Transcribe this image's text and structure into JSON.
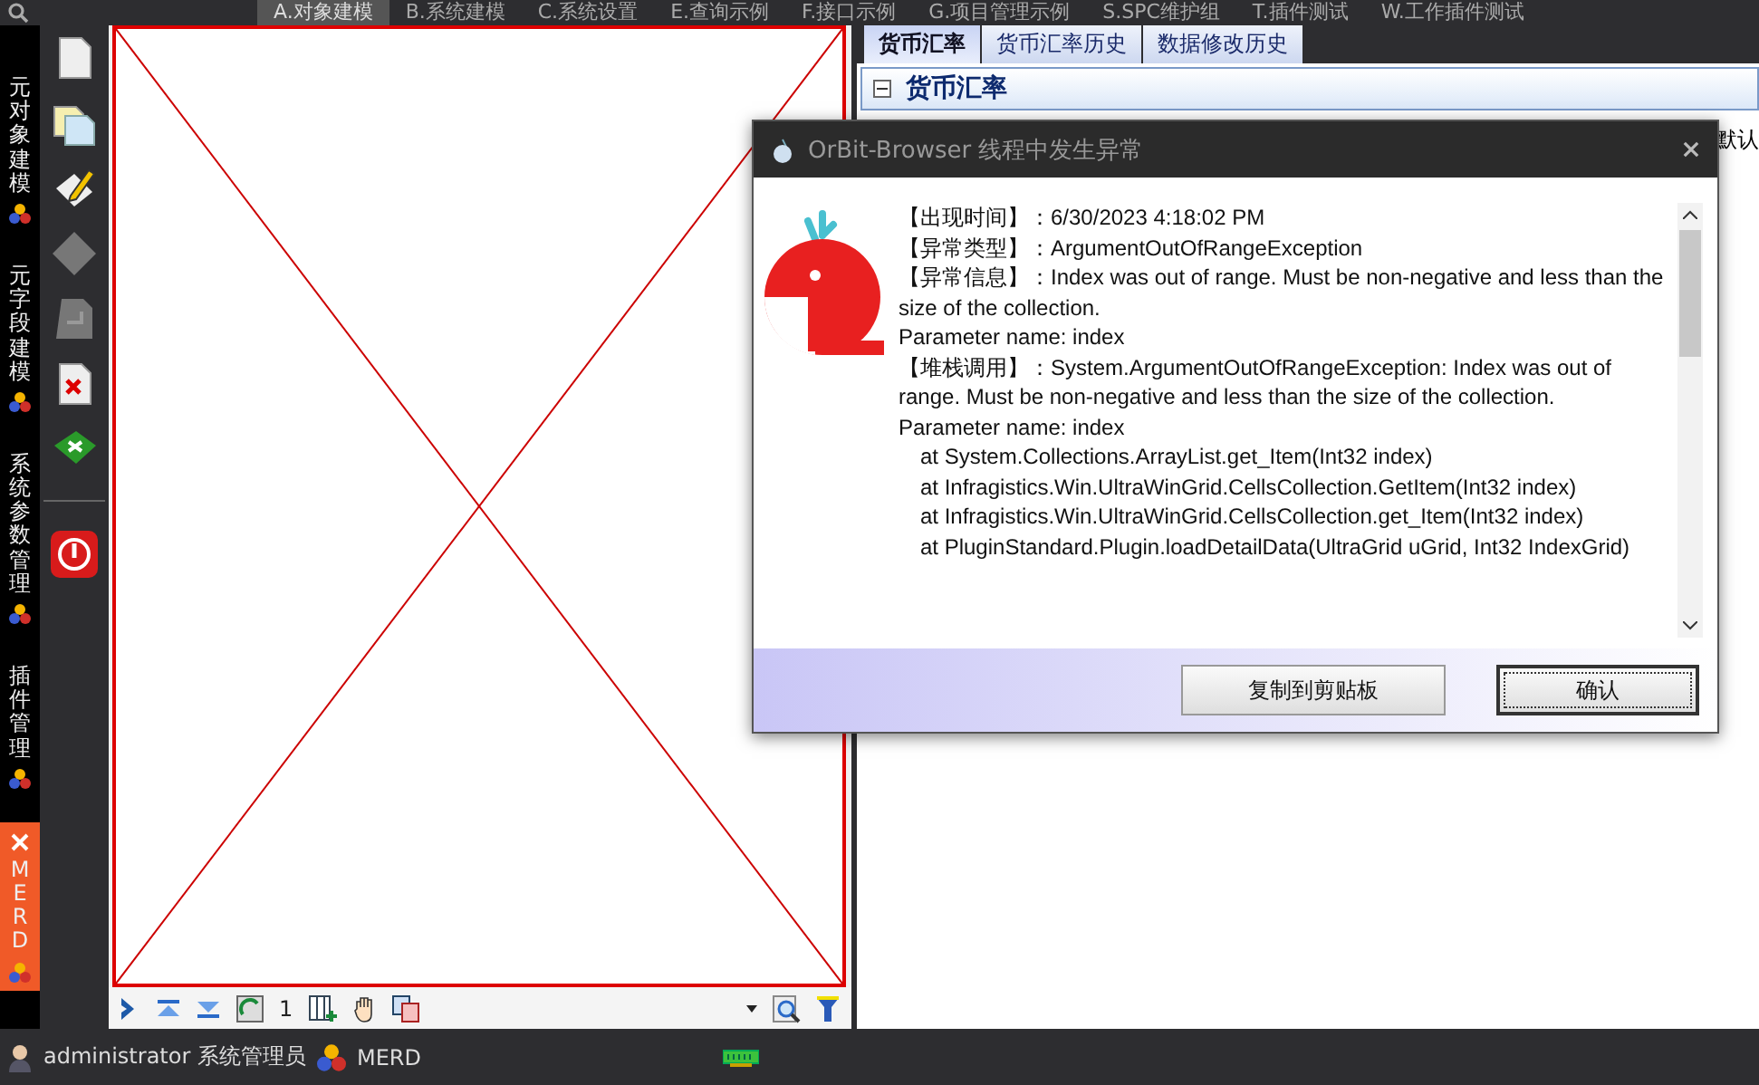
{
  "menu": [
    {
      "label": "A.对象建模",
      "selected": true
    },
    {
      "label": "B.系统建模",
      "selected": false
    },
    {
      "label": "C.系统设置",
      "selected": false
    },
    {
      "label": "E.查询示例",
      "selected": false
    },
    {
      "label": "F.接口示例",
      "selected": false
    },
    {
      "label": "G.项目管理示例",
      "selected": false
    },
    {
      "label": "S.SPC维护组",
      "selected": false
    },
    {
      "label": "T.插件测试",
      "selected": false
    },
    {
      "label": "W.工作插件测试",
      "selected": false
    }
  ],
  "side_tabs": [
    {
      "label": "元对象建模",
      "selected": false,
      "closable": false
    },
    {
      "label": "元字段建模",
      "selected": false,
      "closable": false
    },
    {
      "label": "系统参数管理",
      "selected": false,
      "closable": false
    },
    {
      "label": "插件管理",
      "selected": false,
      "closable": false
    },
    {
      "label": "MERD",
      "selected": true,
      "closable": true
    }
  ],
  "canvas_toolbar": {
    "page": "1"
  },
  "panel": {
    "tabs": [
      {
        "label": "货币汇率",
        "selected": true
      },
      {
        "label": "货币汇率历史",
        "selected": false
      },
      {
        "label": "数据修改历史",
        "selected": false
      }
    ],
    "section_title": "货币汇率",
    "side_label": "默认"
  },
  "dialog": {
    "title": "OrBit-Browser 线程中发生异常",
    "message": [
      {
        "label": "【出现时间】",
        "text": "：6/30/2023 4:18:02 PM"
      },
      {
        "label": "【异常类型】",
        "text": "：ArgumentOutOfRangeException"
      },
      {
        "label": "【异常信息】",
        "text": "：Index was out of range. Must be non-negative and less than the size of the collection."
      },
      {
        "text": "Parameter name: index"
      },
      {
        "label": "【堆栈调用】",
        "text": "：System.ArgumentOutOfRangeException: Index was out of range. Must be non-negative and less than the size of the collection."
      },
      {
        "text": "Parameter name: index"
      }
    ],
    "stack": [
      "at System.Collections.ArrayList.get_Item(Int32 index)",
      "at Infragistics.Win.UltraWinGrid.CellsCollection.GetItem(Int32 index)",
      "at Infragistics.Win.UltraWinGrid.CellsCollection.get_Item(Int32 index)",
      "at PluginStandard.Plugin.loadDetailData(UltraGrid uGrid, Int32 IndexGrid)"
    ],
    "buttons": [
      {
        "label": "复制到剪贴板",
        "default": false
      },
      {
        "label": "确认",
        "default": true
      }
    ]
  },
  "status_bar": {
    "user": "administrator 系统管理员",
    "module": "MERD"
  }
}
